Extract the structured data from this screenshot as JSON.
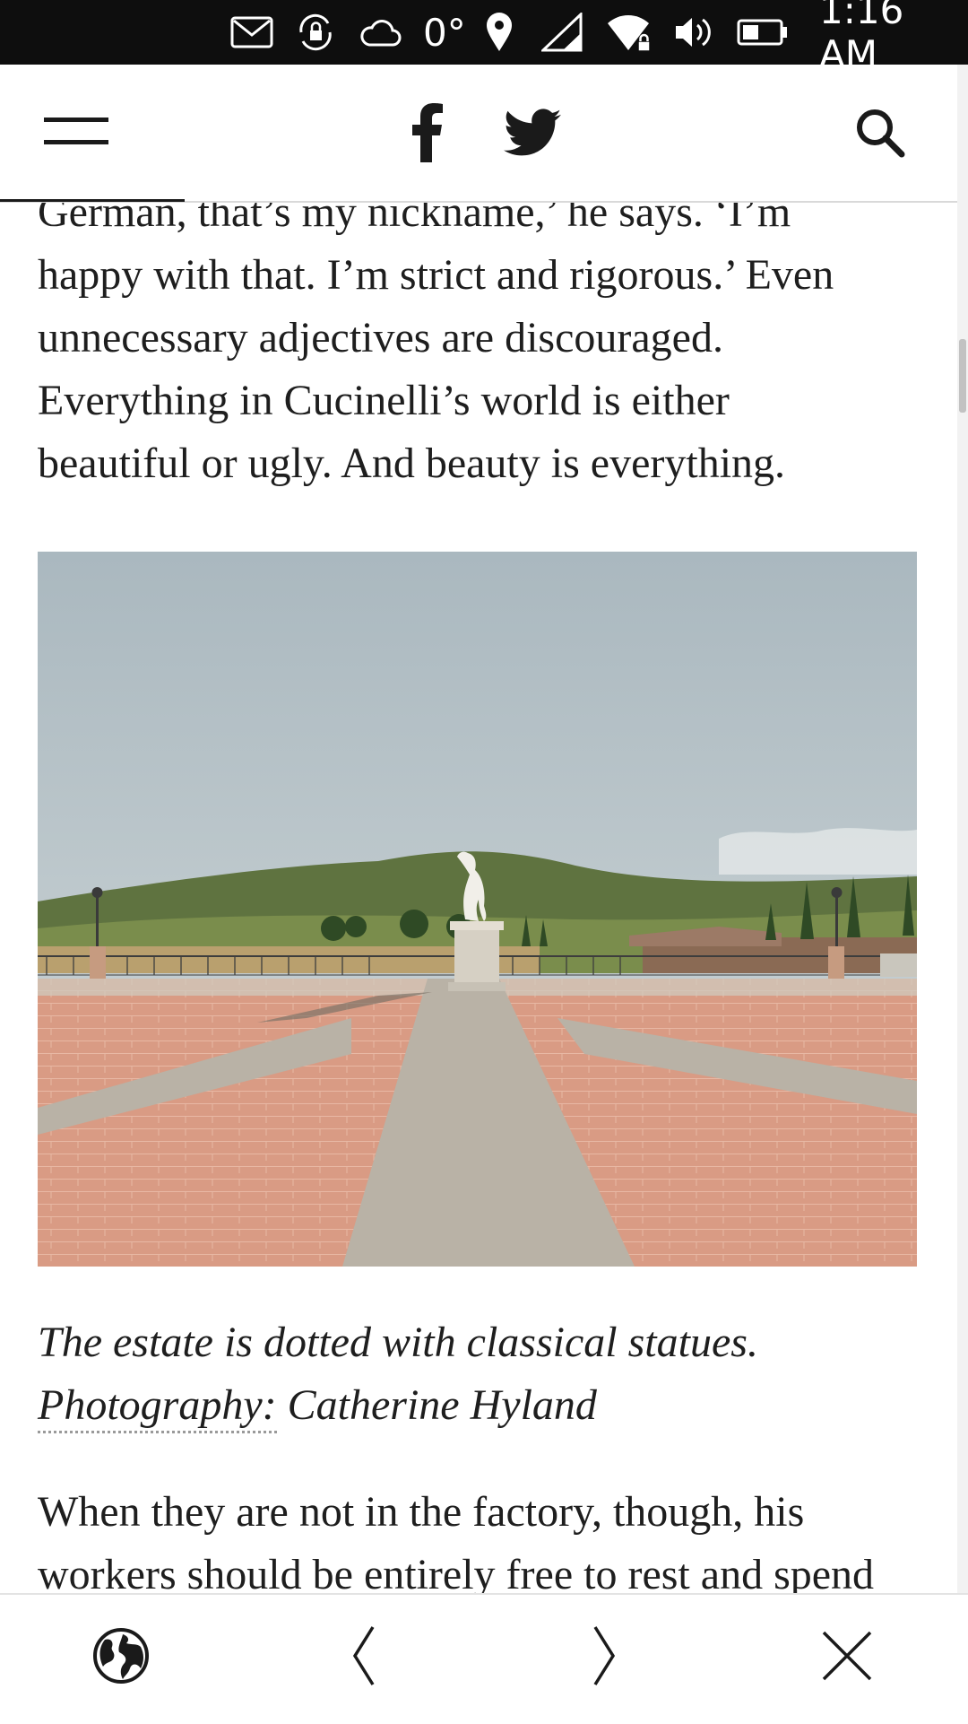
{
  "status_bar": {
    "temperature": "0°",
    "time": "1:16 AM",
    "icons": [
      "mail-icon",
      "sync-lock-icon",
      "cloud-icon",
      "location-pin-icon",
      "cell-signal-icon",
      "wifi-lock-icon",
      "volume-icon",
      "battery-icon"
    ]
  },
  "toolbar": {
    "icons": [
      "menu-icon",
      "facebook-icon",
      "twitter-icon",
      "search-icon"
    ]
  },
  "article": {
    "paragraph_1_lines": [
      "German, that’s my nickname,’ he says. ‘I’m",
      "happy with that. I’m strict and rigorous.’ Even",
      "unnecessary adjectives are discouraged.",
      "Everything in Cucinelli’s world is either",
      "beautiful or ugly. And beauty is everything."
    ],
    "caption_line_1": "The estate is dotted with classical statues.",
    "caption_credit_link": "Photography:",
    "caption_credit_name": " Catherine Hyland",
    "paragraph_2_lines": [
      "When they are not in the factory, though, his",
      "workers should be entirely free to rest and spend"
    ]
  },
  "bottom_nav": {
    "icons": [
      "globe-icon",
      "back-chevron-icon",
      "forward-chevron-icon",
      "close-icon"
    ]
  },
  "colors": {
    "status_bar_bg": "#0e0e0e",
    "text": "#1e1e1e",
    "sky": "#b8c5cb",
    "terracotta": "#d99a82",
    "stone_path": "#b9b2a6"
  }
}
